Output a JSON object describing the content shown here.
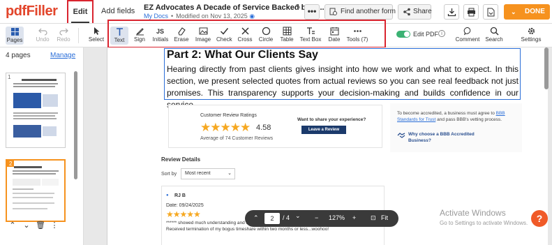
{
  "app": {
    "logo": "pdfFiller"
  },
  "tabs": {
    "edit": "Edit",
    "add_fields": "Add fields"
  },
  "doc": {
    "title": "EZ Advocates A Decade of Service Backed by R...",
    "location": "My Docs",
    "modified": "Modified on Nov 13, 2025"
  },
  "top_actions": {
    "more": "•••",
    "find_form": "Find another form",
    "share": "Share",
    "done": "DONE"
  },
  "toolbar": {
    "pages": "Pages",
    "undo": "Undo",
    "redo": "Redo",
    "select": "Select",
    "text": "Text",
    "sign": "Sign",
    "initials": "Initials",
    "erase": "Erase",
    "image": "Image",
    "check": "Check",
    "cross": "Cross",
    "circle": "Circle",
    "table": "Table",
    "textbox": "Text Box",
    "date": "Date",
    "tools": "Tools (7)",
    "edit_pdf": "Edit PDF",
    "comment": "Comment",
    "search": "Search",
    "settings": "Settings"
  },
  "left": {
    "pages_count": "4 pages",
    "manage": "Manage",
    "thumb1": "1",
    "thumb2": "2"
  },
  "content": {
    "heading": "Part 2: What Our Clients Say",
    "paragraph": "Hearing directly from past clients gives insight into how we work and what to expect. In this section, we present selected quotes from actual reviews so you can see real feedback not just promises. This transparency supports your decision-making and builds confidence in our service.",
    "ratings_title": "Customer Review Ratings",
    "stars": "★★★★★",
    "rating": "4.58",
    "avg": "Average of 74 Customer Reviews",
    "share_exp": "Want to share your experience?",
    "leave_review": "Leave a Review",
    "bbb_text_1": "To become accredited, a business must agree to ",
    "bbb_link": "BBB Standards for Trust",
    "bbb_text_2": " and pass BBB's vetting process.",
    "bbb_why": "Why choose a BBB Accredited Business?",
    "review_details": "Review Details",
    "sort_by": "Sort by",
    "sort_value": "Most recent",
    "reviewer": "RJ B",
    "review_date": "Date: 09/24/2025",
    "review_text": "****** showed much understanding and was always cheerful, in spite of the unpleasant situation. Received termination of my bogus timeshare within two months or less...woohoo!"
  },
  "nav": {
    "page": "2",
    "of": "/ 4",
    "zoom": "127%",
    "fit": "Fit",
    "minus": "−",
    "plus": "+",
    "up": "⌃",
    "down": "⌄"
  },
  "os": {
    "activate_title": "Activate Windows",
    "activate_sub": "Go to Settings to activate Windows."
  },
  "help": "?"
}
